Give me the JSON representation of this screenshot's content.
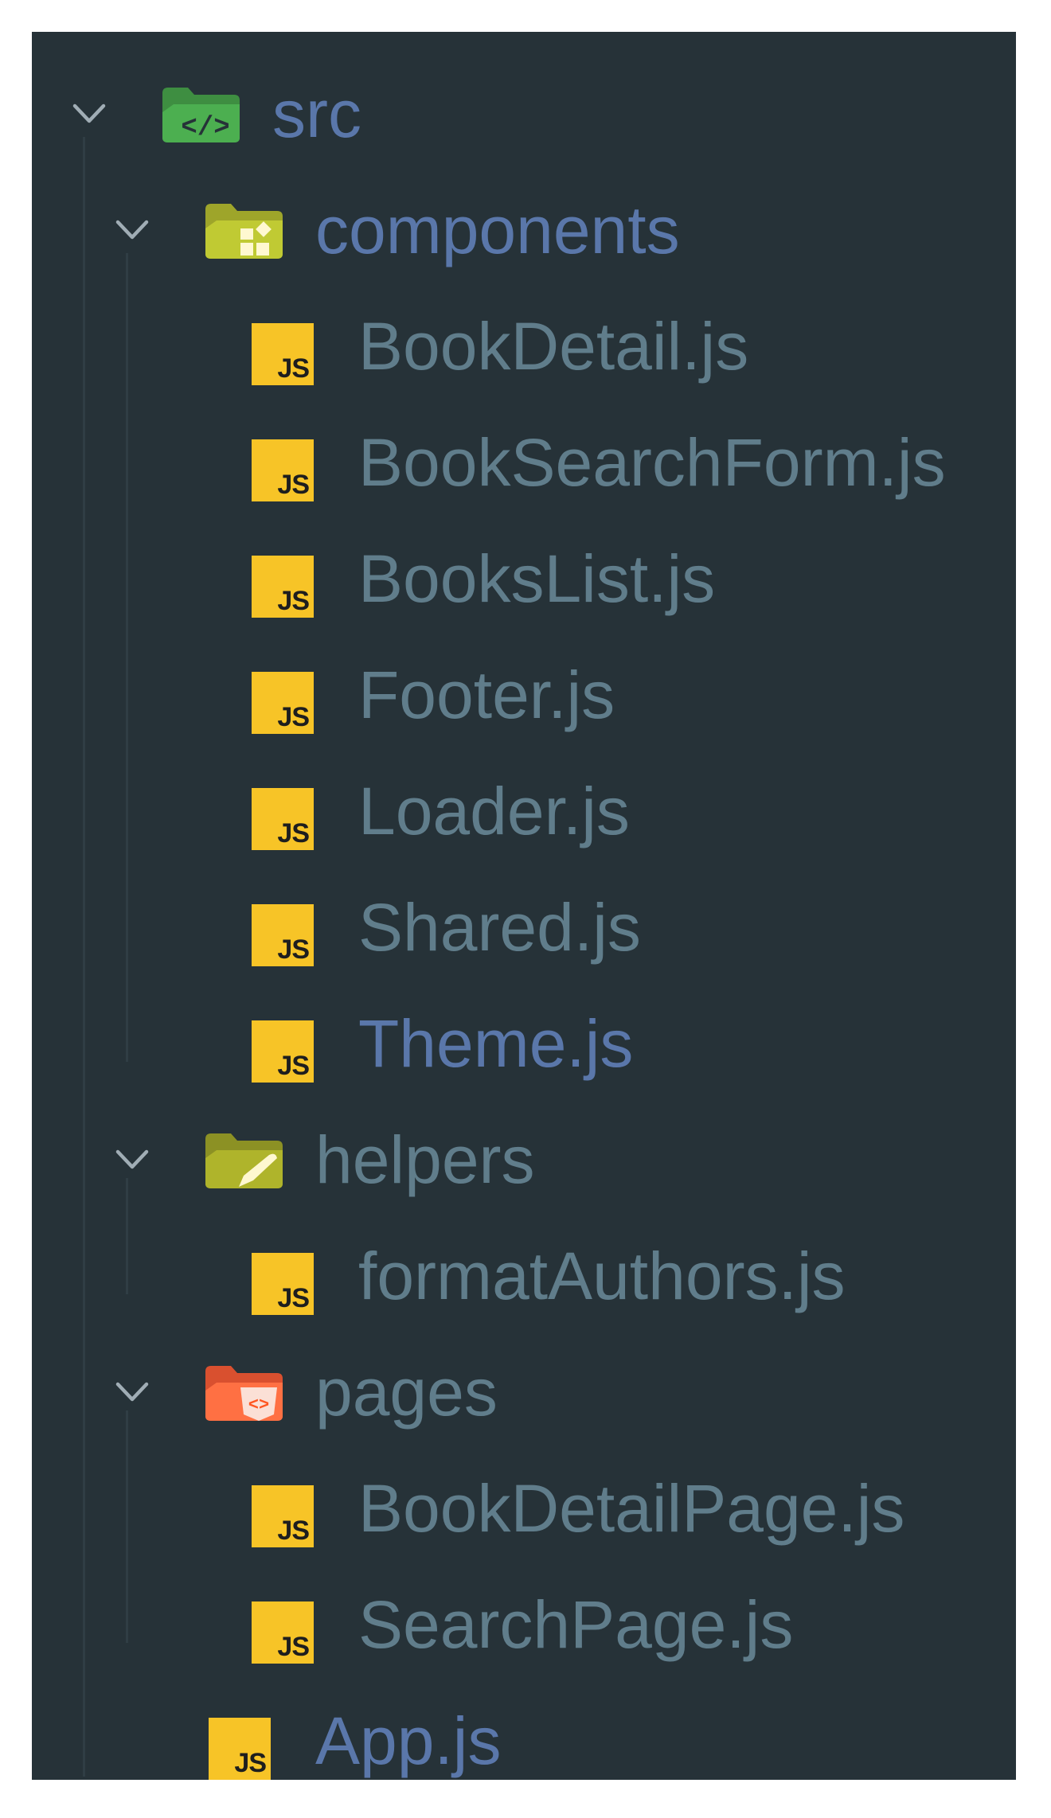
{
  "tree": {
    "root": {
      "label": "src",
      "icon": "folder-src-icon"
    },
    "components": {
      "label": "components",
      "icon": "folder-components-icon",
      "files": [
        {
          "label": "BookDetail.js",
          "icon": "js-file-icon",
          "icon_text": "JS"
        },
        {
          "label": "BookSearchForm.js",
          "icon": "js-file-icon",
          "icon_text": "JS"
        },
        {
          "label": "BooksList.js",
          "icon": "js-file-icon",
          "icon_text": "JS"
        },
        {
          "label": "Footer.js",
          "icon": "js-file-icon",
          "icon_text": "JS"
        },
        {
          "label": "Loader.js",
          "icon": "js-file-icon",
          "icon_text": "JS"
        },
        {
          "label": "Shared.js",
          "icon": "js-file-icon",
          "icon_text": "JS"
        },
        {
          "label": "Theme.js",
          "icon": "js-file-icon",
          "icon_text": "JS"
        }
      ]
    },
    "helpers": {
      "label": "helpers",
      "icon": "folder-helpers-icon",
      "files": [
        {
          "label": "formatAuthors.js",
          "icon": "js-file-icon",
          "icon_text": "JS"
        }
      ]
    },
    "pages": {
      "label": "pages",
      "icon": "folder-pages-icon",
      "files": [
        {
          "label": "BookDetailPage.js",
          "icon": "js-file-icon",
          "icon_text": "JS"
        },
        {
          "label": "SearchPage.js",
          "icon": "js-file-icon",
          "icon_text": "JS"
        }
      ]
    },
    "root_files": [
      {
        "label": "App.js",
        "icon": "js-file-icon",
        "icon_text": "JS"
      }
    ]
  },
  "colors": {
    "background": "#263238",
    "text_default": "#607d8b",
    "text_highlight": "#5a77aa",
    "js_badge": "#f7c427",
    "folder_src": "#4caf50",
    "folder_components": "#c0ca33",
    "folder_helpers": "#afb42b",
    "folder_pages": "#ff7043"
  }
}
